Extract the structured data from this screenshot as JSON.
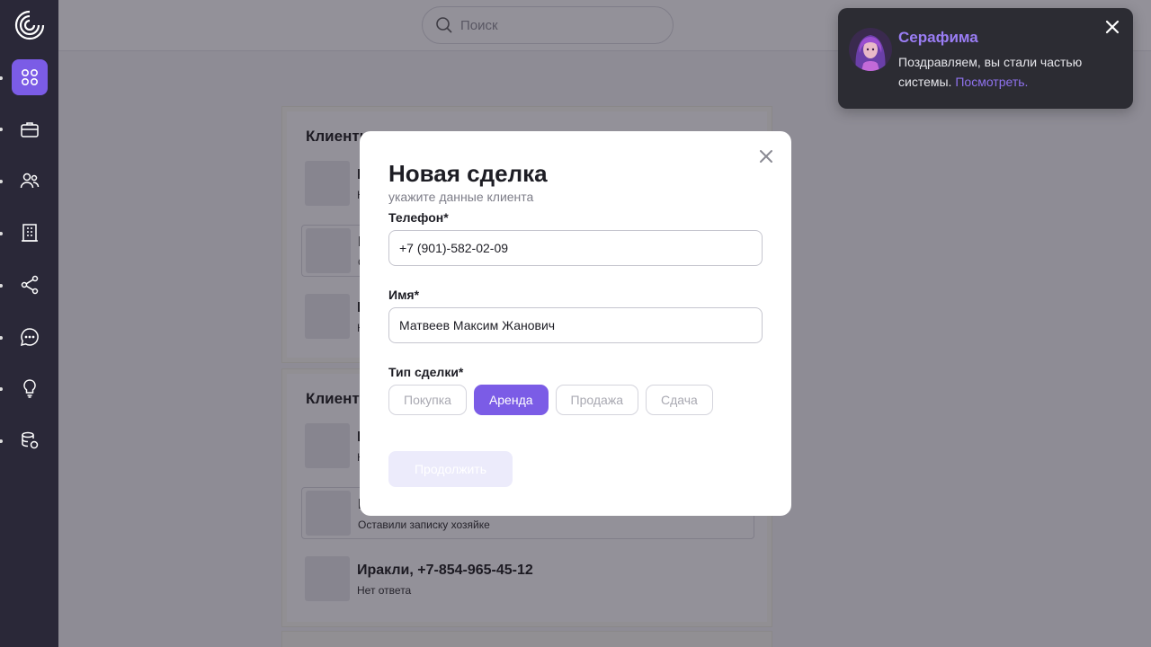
{
  "search": {
    "placeholder": "Поиск"
  },
  "panels": [
    {
      "title": "Клиенты",
      "rows": [
        {
          "title": "Е",
          "sub": "Н"
        },
        {
          "title": "К",
          "sub": "О"
        },
        {
          "title": "И",
          "sub": "Н"
        }
      ]
    },
    {
      "title": "Клиенты",
      "rows": [
        {
          "title": "Е",
          "sub": "Н"
        },
        {
          "title": "К",
          "sub": "Оставили записку хозяйке"
        },
        {
          "title": "Иракли, +7-854-965-45-12",
          "sub": "Нет ответа"
        }
      ]
    }
  ],
  "modal": {
    "title": "Новая сделка",
    "subtitle": "укажите данные клиента",
    "phone_label": "Телефон*",
    "phone_value": "+7 (901)-582-02-09",
    "name_label": "Имя*",
    "name_value": "Матвеев Максим Жанович",
    "deal_type_label": "Тип сделки*",
    "deal_types": [
      {
        "label": "Покупка",
        "selected": false
      },
      {
        "label": "Аренда",
        "selected": true
      },
      {
        "label": "Продажа",
        "selected": false
      },
      {
        "label": "Сдача",
        "selected": false
      }
    ],
    "continue_label": "Продолжить"
  },
  "toast": {
    "name": "Серафима",
    "message": "Поздравляем, вы стали частью системы.",
    "link": "Посмотреть."
  },
  "colors": {
    "accent": "#7b5ce6",
    "sidebar": "#2a2838",
    "toast_bg": "#2c2c33",
    "toast_name": "#9a7df4"
  }
}
